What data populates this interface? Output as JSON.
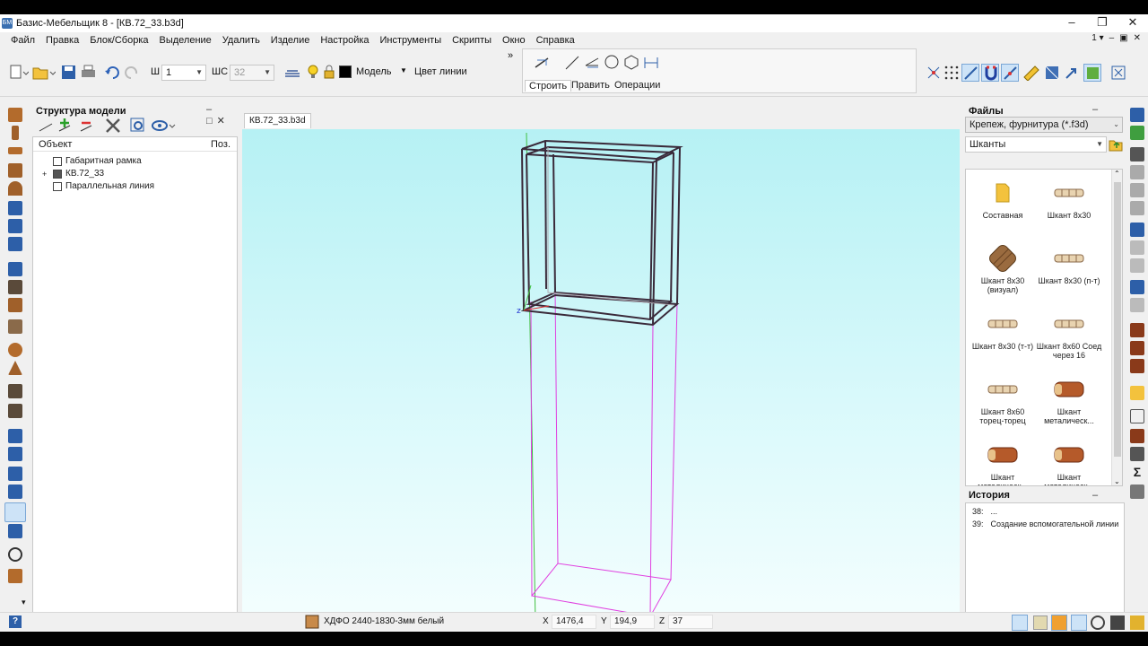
{
  "window": {
    "title": "Базис-Мебельщик 8 - [КВ.72_33.b3d]",
    "app_icon_text": "БМ",
    "min_glyph": "–",
    "max_glyph": "❐",
    "close_glyph": "✕"
  },
  "menu": {
    "items": [
      "Файл",
      "Правка",
      "Блок/Сборка",
      "Выделение",
      "Удалить",
      "Изделие",
      "Настройка",
      "Инструменты",
      "Скрипты",
      "Окно",
      "Справка"
    ],
    "right": [
      "1 ▾",
      "–",
      "▣",
      "✕"
    ]
  },
  "toolbar": {
    "width_label": "Ш",
    "width_value": "1",
    "ws_label": "ШС",
    "ws_value": "32",
    "layer_value": "Модель",
    "line_color_label": "Цвет линии",
    "line_color": "#000000",
    "build_tabs": [
      "Строить",
      "Править",
      "Операции"
    ],
    "chevrons": "»"
  },
  "structure_panel": {
    "title": "Структура модели",
    "col_object": "Объект",
    "col_pos": "Поз.",
    "rows": [
      {
        "label": "Габаритная рамка",
        "expander": ""
      },
      {
        "label": "КВ.72_33",
        "expander": "+"
      },
      {
        "label": "Параллельная линия",
        "expander": ""
      }
    ]
  },
  "viewport": {
    "tab_label": "КВ.72_33.b3d",
    "bg_top": "#b6f1f4",
    "frame_color": "#3a2a3a",
    "guide_color": "#e040e0",
    "axis_color": "#40c040"
  },
  "files_panel": {
    "title": "Файлы",
    "category": "Крепеж, фурнитура (*.f3d)",
    "subfolder": "Шканты",
    "items": [
      {
        "label": "Составная",
        "icon": "folder-icon"
      },
      {
        "label": "Шкант 8x30",
        "icon": "dowel-icon"
      },
      {
        "label": "Шкант 8x30 (визуал)",
        "icon": "dowel-visual-icon"
      },
      {
        "label": "Шкант 8x30 (п-т)",
        "icon": "dowel-icon"
      },
      {
        "label": "Шкант 8x30 (т-т)",
        "icon": "dowel-icon"
      },
      {
        "label": "Шкант 8x60 Соед через 16",
        "icon": "dowel-icon"
      },
      {
        "label": "Шкант 8x60 торец-торец",
        "icon": "dowel-icon"
      },
      {
        "label": "Шкант металическ...",
        "icon": "metal-dowel-icon"
      },
      {
        "label": "Шкант металическ...",
        "icon": "metal-dowel-icon"
      },
      {
        "label": "Шкант металическ...",
        "icon": "metal-dowel-icon"
      }
    ]
  },
  "history_panel": {
    "title": "История",
    "rows": [
      {
        "num": "38:",
        "text": "..."
      },
      {
        "num": "39:",
        "text": "Создание вспомогательной линии"
      }
    ]
  },
  "status": {
    "material": "ХДФО 2440-1830-3мм белый",
    "x_label": "X",
    "x_value": "1476,4",
    "y_label": "Y",
    "y_value": "194,9",
    "z_label": "Z",
    "z_value": "37",
    "help_glyph": "?"
  }
}
